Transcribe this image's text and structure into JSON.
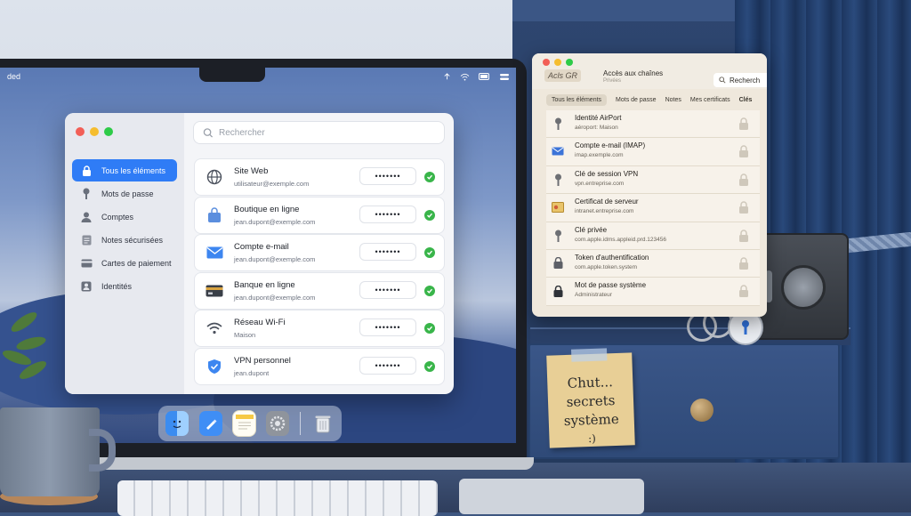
{
  "macos": {
    "menubar_left": "ded"
  },
  "passwords_app": {
    "search_placeholder": "Rechercher",
    "sidebar": [
      {
        "label": "Tous les éléments",
        "icon": "lock-icon",
        "active": true
      },
      {
        "label": "Mots de passe",
        "icon": "key-icon",
        "active": false
      },
      {
        "label": "Comptes",
        "icon": "person-icon",
        "active": false
      },
      {
        "label": "Notes sécurisées",
        "icon": "note-icon",
        "active": false
      },
      {
        "label": "Cartes de paiement",
        "icon": "credit-card-icon",
        "active": false
      },
      {
        "label": "Identités",
        "icon": "id-card-icon",
        "active": false
      }
    ],
    "items": [
      {
        "title": "Site Web",
        "subtitle": "utilisateur@exemple.com",
        "password": "•••••••",
        "icon": "globe-icon"
      },
      {
        "title": "Boutique en ligne",
        "subtitle": "jean.dupont@exemple.com",
        "password": "•••••••",
        "icon": "shopping-bag-icon"
      },
      {
        "title": "Compte e-mail",
        "subtitle": "jean.dupont@exemple.com",
        "password": "•••••••",
        "icon": "envelope-icon"
      },
      {
        "title": "Banque en ligne",
        "subtitle": "jean.dupont@exemple.com",
        "password": "•••••••",
        "icon": "bank-card-icon"
      },
      {
        "title": "Réseau Wi-Fi",
        "subtitle": "Maison",
        "password": "•••••••",
        "icon": "wifi-icon"
      },
      {
        "title": "VPN personnel",
        "subtitle": "jean.dupont",
        "password": "•••••••",
        "icon": "shield-check-icon"
      }
    ]
  },
  "dock": [
    {
      "name": "finder-icon"
    },
    {
      "name": "pen-app-icon"
    },
    {
      "name": "notes-icon"
    },
    {
      "name": "system-settings-icon"
    },
    {
      "name": "trash-icon"
    }
  ],
  "keychain": {
    "logo_text": "Acls GR",
    "title": "Accès aux chaînes",
    "subtitle": "Privées",
    "search_label": "Recherch",
    "tabs": [
      {
        "label": "Tous les éléments",
        "active": true
      },
      {
        "label": "Mots de passe",
        "active": false
      },
      {
        "label": "Notes",
        "active": false
      },
      {
        "label": "Mes certificats",
        "active": false
      },
      {
        "label": "Clés",
        "active": false
      }
    ],
    "items": [
      {
        "title": "Identité AirPort",
        "subtitle": "aéroport: Maison",
        "icon": "key-icon"
      },
      {
        "title": "Compte e-mail (IMAP)",
        "subtitle": "imap.exemple.com",
        "icon": "envelope-icon"
      },
      {
        "title": "Clé de session VPN",
        "subtitle": "vpn.entreprise.com",
        "icon": "key-icon"
      },
      {
        "title": "Certificat de serveur",
        "subtitle": "intranet.entreprise.com",
        "icon": "certificate-icon"
      },
      {
        "title": "Clé privée",
        "subtitle": "com.apple.idms.appleid.prd.123456",
        "icon": "key-icon"
      },
      {
        "title": "Token d'authentification",
        "subtitle": "com.apple.token.system",
        "icon": "lock-icon"
      },
      {
        "title": "Mot de passe système",
        "subtitle": "Administrateur",
        "icon": "lock-icon"
      }
    ]
  },
  "sticky_note": {
    "lines": [
      "Chut...",
      "secrets",
      "système",
      ":)"
    ]
  },
  "colors": {
    "accent": "#2f7cf6",
    "success": "#39b54a",
    "traffic_red": "#f25f57",
    "traffic_yellow": "#f5bd2f",
    "traffic_green": "#2ecb48"
  }
}
